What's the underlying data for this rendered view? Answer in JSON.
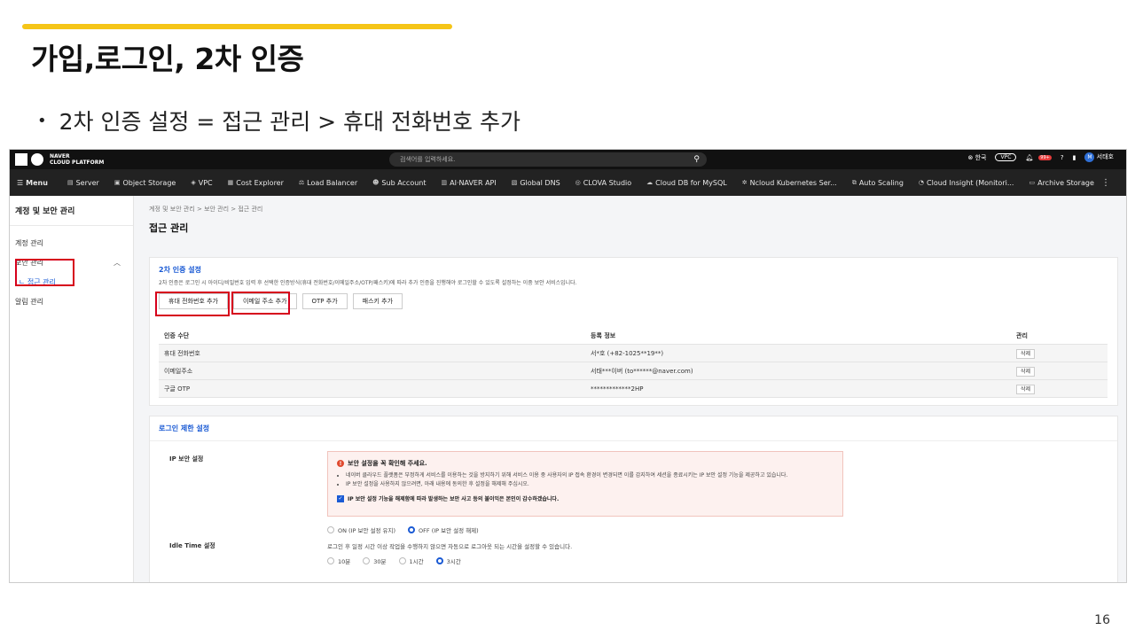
{
  "slide": {
    "title": "가입,로그인, 2차 인증",
    "bullet": "2차 인증 설정 = 접근 관리 > 휴대 전화번호 추가",
    "page_number": "16",
    "accent_color": "#f5c518"
  },
  "topbar": {
    "logo_line1": "NAVER",
    "logo_line2": "CLOUD PLATFORM",
    "search_placeholder": "검색어를 입력하세요.",
    "lang": "한국",
    "vpc": "VPC",
    "notif_badge": "99+",
    "avatar_letter": "M",
    "user_name": "서태호"
  },
  "menubar": {
    "menu_label": "Menu",
    "items": [
      "Server",
      "Object Storage",
      "VPC",
      "Cost Explorer",
      "Load Balancer",
      "Sub Account",
      "AI·NAVER API",
      "Global DNS",
      "CLOVA Studio",
      "Cloud DB for MySQL",
      "Ncloud Kubernetes Ser...",
      "Auto Scaling",
      "Cloud Insight (Monitori...",
      "Archive Storage"
    ]
  },
  "sidebar": {
    "title": "계정 및 보안 관리",
    "items": [
      "계정 관리",
      "보안 관리",
      "ㄴ 접근 관리",
      "알림 관리"
    ]
  },
  "main": {
    "breadcrumb": "계정 및 보안 관리  >  보안 관리  >  접근 관리",
    "page_title": "접근 관리",
    "twofa": {
      "title": "2차 인증 설정",
      "desc": "2차 인증은 로그인 시 아이디/비밀번호 입력 후 선택한 인증방식(휴대 전화번호/이메일주소/OTP/패스키)에 따라 추가 인증을 진행해야 로그인할 수 있도록 설정하는 이중 보안 서비스입니다.",
      "buttons": [
        "휴대 전화번호 추가",
        "이메일 주소 추가",
        "OTP 추가",
        "패스키 추가"
      ],
      "columns": [
        "인증 수단",
        "등록 정보",
        "관리"
      ],
      "rows": [
        {
          "method": "휴대 전화번호",
          "info": "서*호 (+82-1025**19**)",
          "action": "삭제"
        },
        {
          "method": "이메일주소",
          "info": "서태***이버 (to******@naver.com)",
          "action": "삭제"
        },
        {
          "method": "구글 OTP",
          "info": "*************2HP",
          "action": "삭제"
        }
      ]
    },
    "login_limit": {
      "title": "로그인 제한 설정",
      "ip_label": "IP 보안 설정",
      "warn_title": "보안 설정을 꼭 확인해 주세요.",
      "warn_lines": [
        "네이버 클라우드 플랫폼은 부정하게 서비스를 이용하는 것을 방지하기 위해 서비스 이용 중 사용자의 IP 접속 환경이 변경되면 이를 감지하여 세션을 종료시키는 IP 보안 설정 기능을 제공하고 있습니다.",
        "IP 보안 설정을 사용하지 않으려면, 아래 내용에 동의한 후 설정을 해제해 주십시오."
      ],
      "agree": "IP 보안 설정 기능을 해제함에 따라 발생하는 보안 사고 등의 불이익은 본인이 감수하겠습니다.",
      "ip_options": [
        "ON (IP 보안 설정 유지)",
        "OFF (IP 보안 설정 해제)"
      ],
      "idle_label": "Idle Time 설정",
      "idle_desc": "로그인 후 일정 시간 이상 작업을 수행하지 않으면 자동으로 로그아웃 되는 시간을 설정할 수 있습니다.",
      "idle_options": [
        "10분",
        "30분",
        "1시간",
        "3시간"
      ]
    }
  }
}
